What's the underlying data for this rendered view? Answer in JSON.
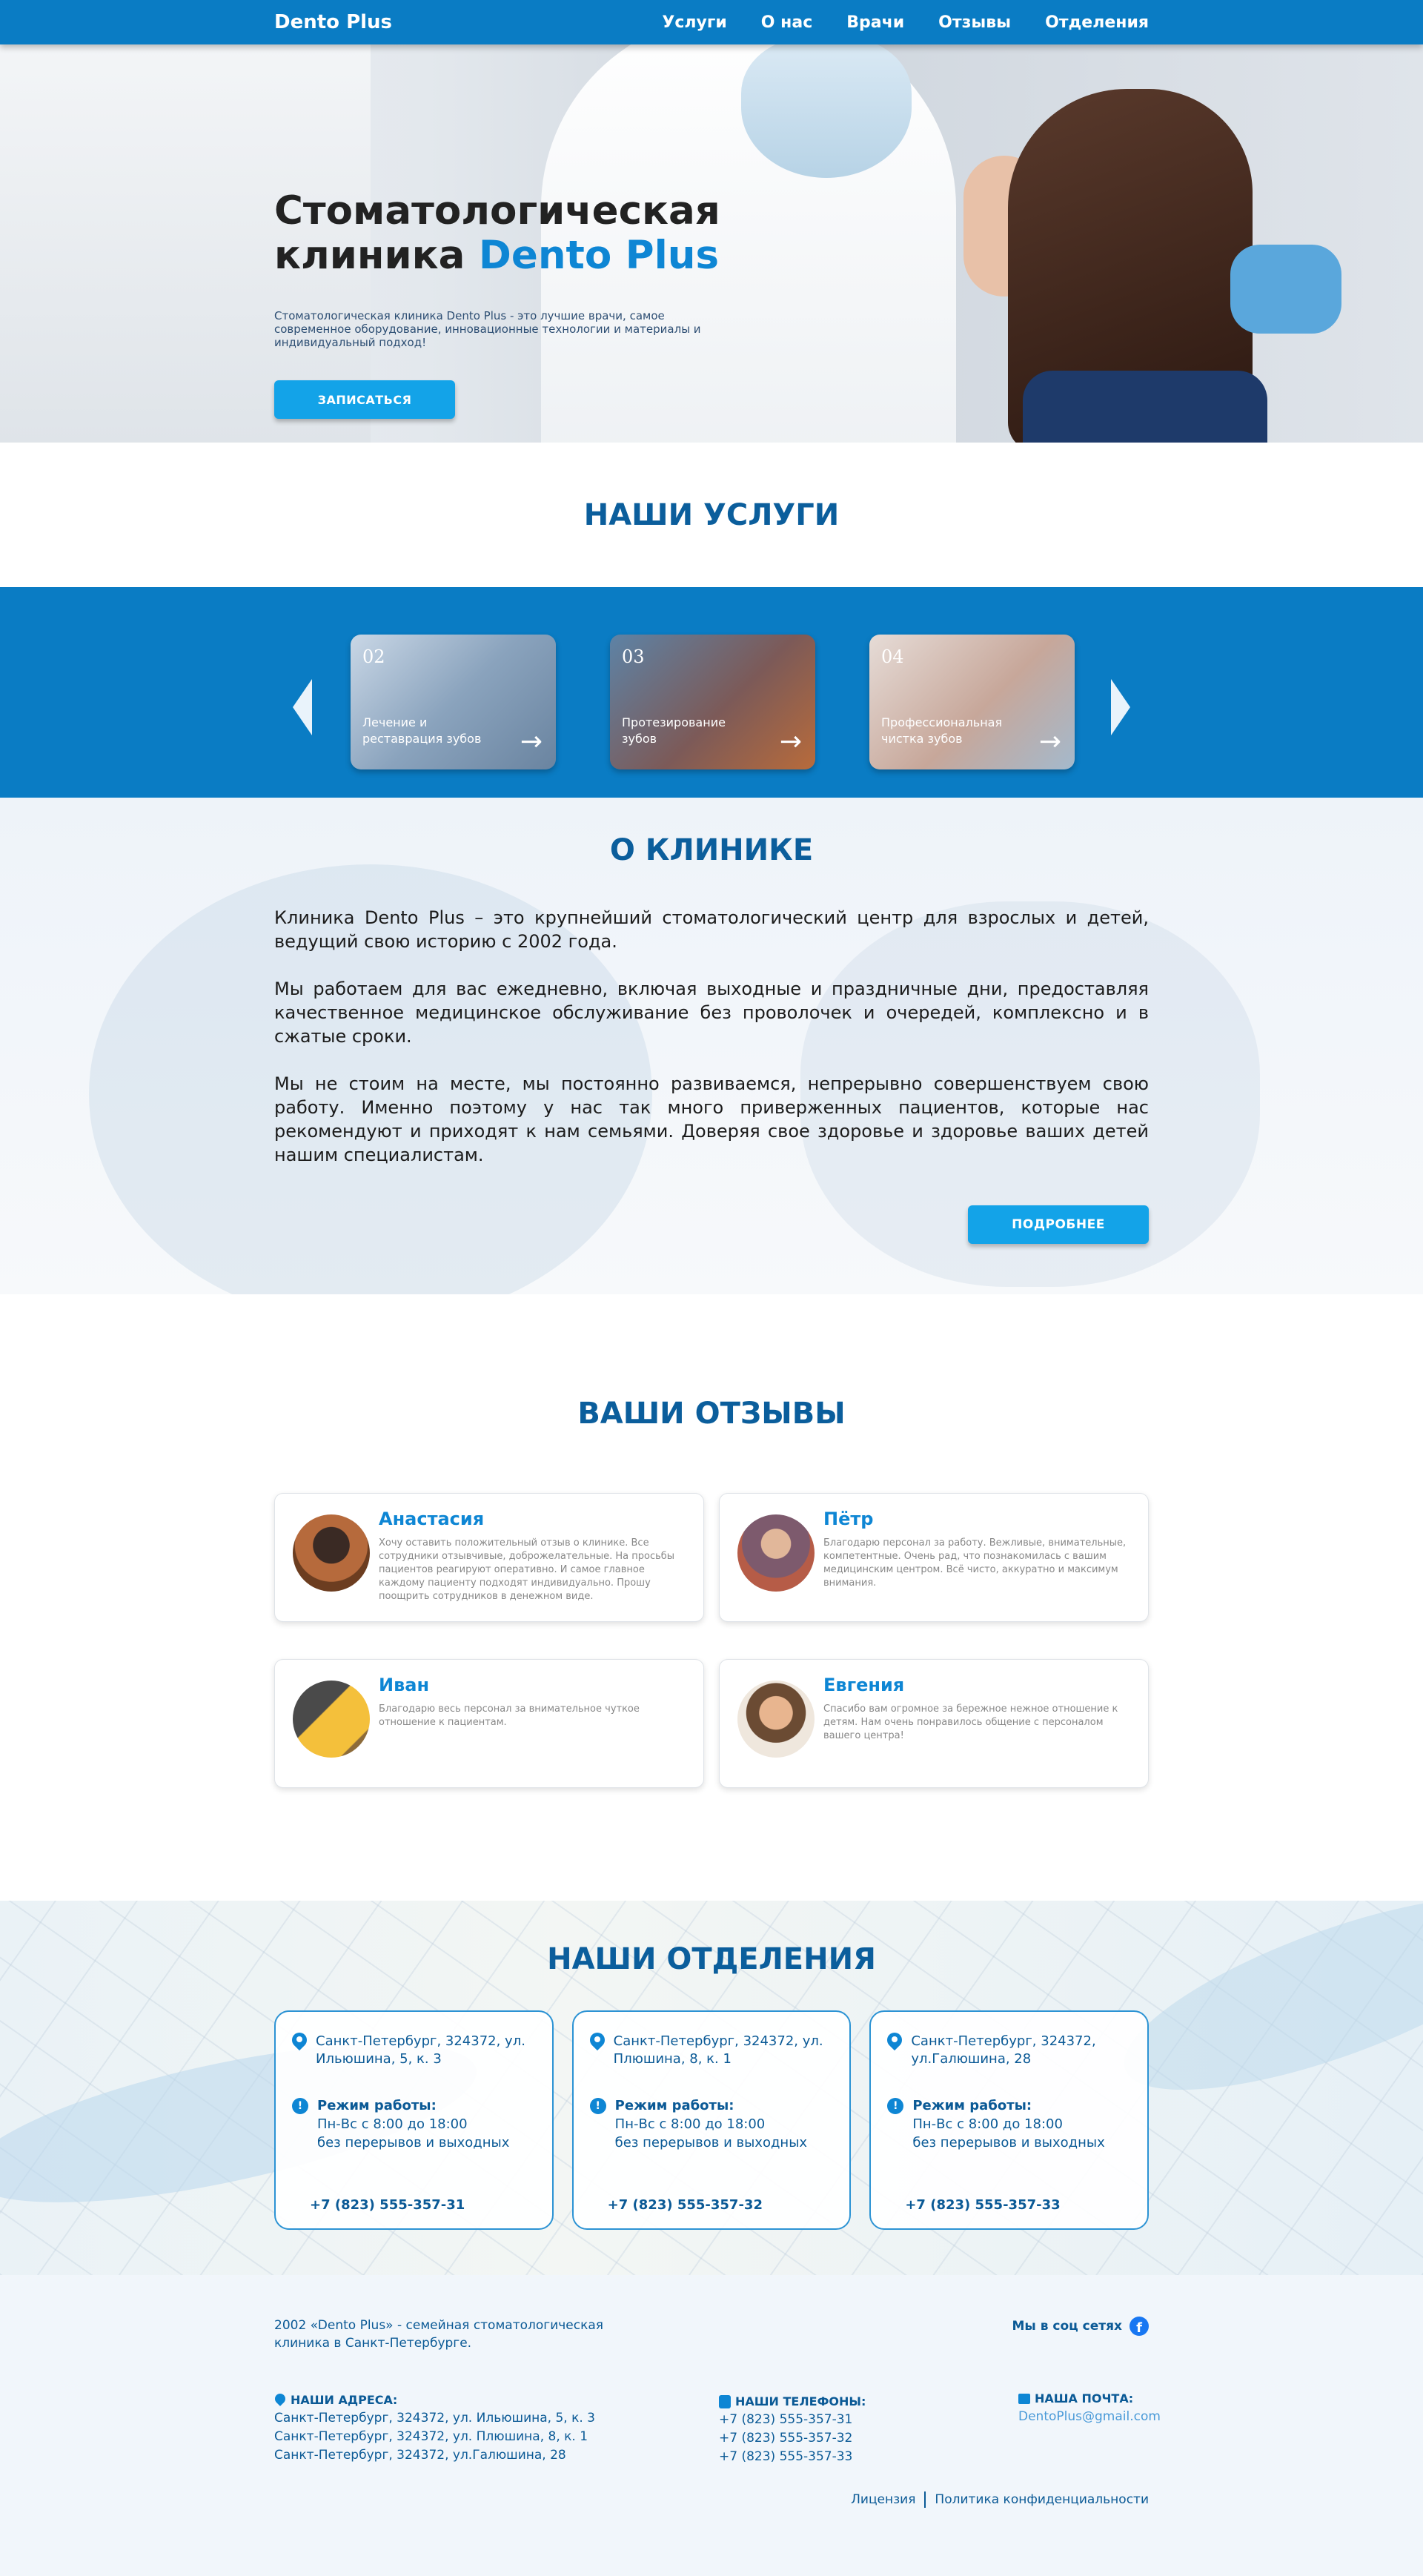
{
  "nav": {
    "logo": "Dento Plus",
    "items": [
      "Услуги",
      "О нас",
      "Врачи",
      "Отзывы",
      "Отделения"
    ]
  },
  "hero": {
    "title_line1": "Стоматологическая",
    "title_line2_prefix": "клиника ",
    "title_line2_accent": "Dento Plus",
    "description": "Стоматологическая клиника Dento Plus - это лучшие врачи, самое современное оборудование, инновационные технологии и материалы и индивидуальный подход!",
    "cta": "ЗАПИСАТЬСЯ"
  },
  "services": {
    "title": "НАШИ УСЛУГИ",
    "cards": [
      {
        "num": "02",
        "label": "Лечение и реставрация зубов"
      },
      {
        "num": "03",
        "label": "Протезирование зубов"
      },
      {
        "num": "04",
        "label": "Профессиональная чистка зубов"
      }
    ]
  },
  "about": {
    "title": "О КЛИНИКЕ",
    "paragraphs": [
      "Клиника Dento Plus  – это крупнейший стоматологический центр для взрослых и детей, ведущий свою историю с 2002 года.",
      "Мы работаем для вас ежедневно, включая выходные и праздничные дни, предоставляя качественное медицинское обслуживание без проволочек и очередей, комплексно и в сжатые сроки.",
      "Мы не стоим на месте, мы постоянно развиваемся, непрерывно совершенствуем свою работу. Именно поэтому у нас так много приверженных пациентов, которые нас рекомендуют и приходят к нам семьями. Доверяя свое здоровье и здоровье ваших детей нашим специалистам."
    ],
    "button": "ПОДРОБНЕЕ"
  },
  "reviews": {
    "title": "ВАШИ ОТЗЫВЫ",
    "items": [
      {
        "name": "Анастасия",
        "text": "Хочу оставить положительный отзыв о клинике. Все сотрудники отзывчивые, доброжелательные. На просьбы пациентов реагируют оперативно. И самое главное каждому пациенту подходят индивидуально. Прошу поощрить сотрудников в денежном виде."
      },
      {
        "name": "Пётр",
        "text": "Благодарю персонал за работу. Вежливые, внимательные, компетентные. Очень рад, что познакомилась с вашим медицинским центром. Всё чисто, аккуратно и максимум внимания."
      },
      {
        "name": "Иван",
        "text": "Благодарю весь персонал за внимательное чуткое отношение к пациентам."
      },
      {
        "name": "Евгения",
        "text": "Спасибо вам огромное за бережное нежное отношение к детям. Нам очень понравилось общение с персоналом вашего центра!"
      }
    ]
  },
  "branches": {
    "title": "НАШИ ОТДЕЛЕНИЯ",
    "hours_label": "Режим работы:",
    "hours_line1": "Пн-Вс с 8:00 до 18:00",
    "hours_line2": "без перерывов и выходных",
    "items": [
      {
        "address": "Санкт-Петербург, 324372, ул. Ильюшина, 5, к. 3",
        "phone": "+7 (823) 555-357-31"
      },
      {
        "address": "Санкт-Петербург, 324372, ул. Плюшина, 8, к. 1",
        "phone": "+7 (823) 555-357-32"
      },
      {
        "address": "Санкт-Петербург, 324372, ул.Галюшина, 28",
        "phone": "+7 (823) 555-357-33"
      }
    ]
  },
  "footer": {
    "about": "2002 «Dento Plus» - семейная стоматологическая клиника в Санкт-Петербурге.",
    "social_label": "Мы в соц сетях",
    "addresses_head": "НАШИ АДРЕСА:",
    "addresses": [
      "Санкт-Петербург, 324372, ул. Ильюшина, 5, к. 3",
      "Санкт-Петербург, 324372, ул. Плюшина, 8, к. 1",
      "Санкт-Петербург, 324372, ул.Галюшина, 28"
    ],
    "phones_head": "НАШИ ТЕЛЕФОНЫ:",
    "phones": [
      "+7 (823) 555-357-31",
      "+7 (823) 555-357-32",
      "+7 (823) 555-357-33"
    ],
    "mail_head": "НАША ПОЧТА:",
    "mail": "DentoPlus@gmail.com",
    "license": "Лицензия",
    "privacy": "Политика конфиденциальности"
  },
  "colors": {
    "brand": "#0a7cc4",
    "accent": "#13a3e8",
    "heading": "#0b5e9c"
  }
}
